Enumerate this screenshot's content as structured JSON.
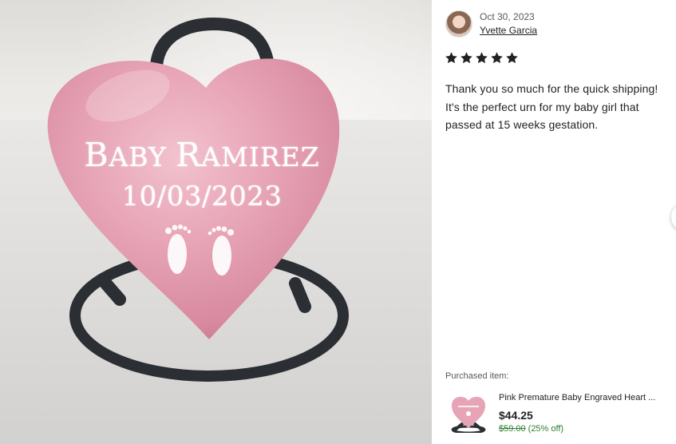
{
  "photo": {
    "engraving_line1_first": "B",
    "engraving_line1_a": "ABY ",
    "engraving_line1_second": "R",
    "engraving_line1_b": "AMIREZ",
    "engraving_date": "10/03/2023",
    "urn_color": "#e7a4b6",
    "stand_color": "#2b2f33",
    "icons": [
      "heart-urn-icon",
      "baby-footprints-icon"
    ]
  },
  "review": {
    "date": "Oct 30, 2023",
    "reviewer_name": "Yvette Garcia",
    "rating": 5,
    "rating_max": 5,
    "text": "Thank you so much for the quick shipping! It's the perfect urn for my baby girl that passed at 15 weeks gestation.",
    "next_icon": "chevron-right-icon",
    "purchased_label": "Purchased item:",
    "item": {
      "title": "Pink Premature Baby Engraved Heart ...",
      "price": "$44.25",
      "original_price": "$59.00",
      "discount": "(25% off)"
    },
    "colors": {
      "text": "#222222",
      "muted": "#595959",
      "sale_green": "#2f7d32"
    }
  }
}
